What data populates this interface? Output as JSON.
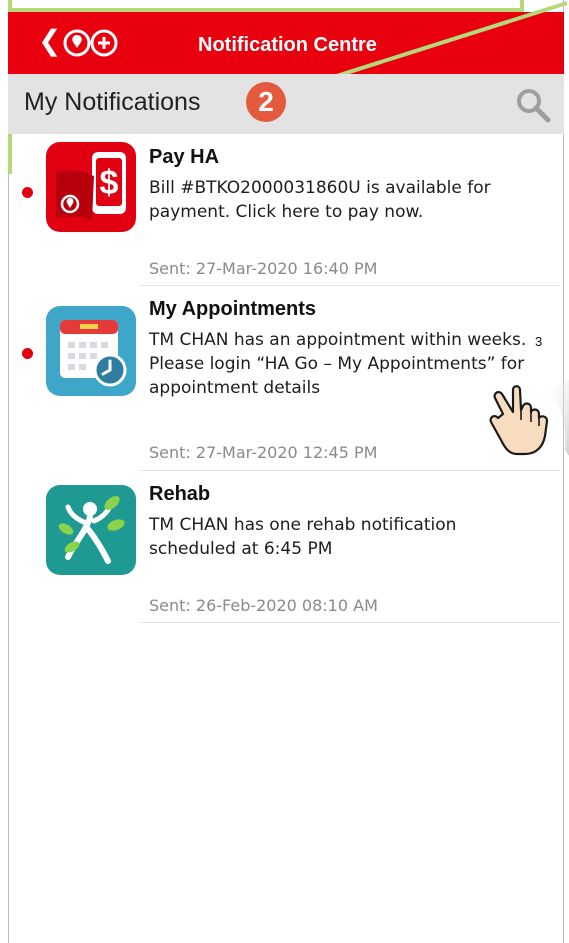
{
  "header": {
    "back_glyph": "❮",
    "title": "Notification Centre",
    "brand_color": "#e8000f"
  },
  "subheader": {
    "title": "My Notifications",
    "badge": "2",
    "search_icon": "search-icon"
  },
  "notifications": [
    {
      "app": "Pay HA",
      "message": "Bill #BTKO2000031860U is available for payment. Click here to pay now.",
      "sent": "Sent: 27-Mar-2020 16:40 PM",
      "unread": true
    },
    {
      "app": "My Appointments",
      "message": "TM CHAN has an appointment within weeks. Please login “HA Go – My Appointments” for appointment details",
      "sent": "Sent: 27-Mar-2020 12:45 PM",
      "unread": true
    },
    {
      "app": "Rehab",
      "message": "TM CHAN has one rehab notification scheduled at 6:45 PM",
      "sent": "Sent: 26-Feb-2020 08:10 AM",
      "unread": false
    }
  ],
  "annotation_number": "3"
}
